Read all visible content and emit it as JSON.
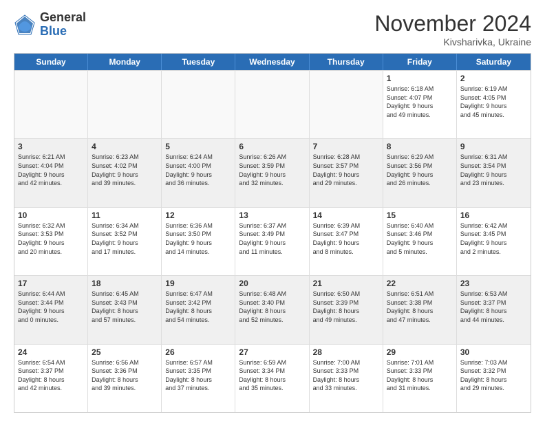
{
  "logo": {
    "general": "General",
    "blue": "Blue"
  },
  "header": {
    "title": "November 2024",
    "subtitle": "Kivsharivka, Ukraine"
  },
  "days": [
    "Sunday",
    "Monday",
    "Tuesday",
    "Wednesday",
    "Thursday",
    "Friday",
    "Saturday"
  ],
  "rows": [
    [
      {
        "day": "",
        "info": "",
        "empty": true
      },
      {
        "day": "",
        "info": "",
        "empty": true
      },
      {
        "day": "",
        "info": "",
        "empty": true
      },
      {
        "day": "",
        "info": "",
        "empty": true
      },
      {
        "day": "",
        "info": "",
        "empty": true
      },
      {
        "day": "1",
        "info": "Sunrise: 6:18 AM\nSunset: 4:07 PM\nDaylight: 9 hours\nand 49 minutes."
      },
      {
        "day": "2",
        "info": "Sunrise: 6:19 AM\nSunset: 4:05 PM\nDaylight: 9 hours\nand 45 minutes."
      }
    ],
    [
      {
        "day": "3",
        "info": "Sunrise: 6:21 AM\nSunset: 4:04 PM\nDaylight: 9 hours\nand 42 minutes."
      },
      {
        "day": "4",
        "info": "Sunrise: 6:23 AM\nSunset: 4:02 PM\nDaylight: 9 hours\nand 39 minutes."
      },
      {
        "day": "5",
        "info": "Sunrise: 6:24 AM\nSunset: 4:00 PM\nDaylight: 9 hours\nand 36 minutes."
      },
      {
        "day": "6",
        "info": "Sunrise: 6:26 AM\nSunset: 3:59 PM\nDaylight: 9 hours\nand 32 minutes."
      },
      {
        "day": "7",
        "info": "Sunrise: 6:28 AM\nSunset: 3:57 PM\nDaylight: 9 hours\nand 29 minutes."
      },
      {
        "day": "8",
        "info": "Sunrise: 6:29 AM\nSunset: 3:56 PM\nDaylight: 9 hours\nand 26 minutes."
      },
      {
        "day": "9",
        "info": "Sunrise: 6:31 AM\nSunset: 3:54 PM\nDaylight: 9 hours\nand 23 minutes."
      }
    ],
    [
      {
        "day": "10",
        "info": "Sunrise: 6:32 AM\nSunset: 3:53 PM\nDaylight: 9 hours\nand 20 minutes."
      },
      {
        "day": "11",
        "info": "Sunrise: 6:34 AM\nSunset: 3:52 PM\nDaylight: 9 hours\nand 17 minutes."
      },
      {
        "day": "12",
        "info": "Sunrise: 6:36 AM\nSunset: 3:50 PM\nDaylight: 9 hours\nand 14 minutes."
      },
      {
        "day": "13",
        "info": "Sunrise: 6:37 AM\nSunset: 3:49 PM\nDaylight: 9 hours\nand 11 minutes."
      },
      {
        "day": "14",
        "info": "Sunrise: 6:39 AM\nSunset: 3:47 PM\nDaylight: 9 hours\nand 8 minutes."
      },
      {
        "day": "15",
        "info": "Sunrise: 6:40 AM\nSunset: 3:46 PM\nDaylight: 9 hours\nand 5 minutes."
      },
      {
        "day": "16",
        "info": "Sunrise: 6:42 AM\nSunset: 3:45 PM\nDaylight: 9 hours\nand 2 minutes."
      }
    ],
    [
      {
        "day": "17",
        "info": "Sunrise: 6:44 AM\nSunset: 3:44 PM\nDaylight: 9 hours\nand 0 minutes."
      },
      {
        "day": "18",
        "info": "Sunrise: 6:45 AM\nSunset: 3:43 PM\nDaylight: 8 hours\nand 57 minutes."
      },
      {
        "day": "19",
        "info": "Sunrise: 6:47 AM\nSunset: 3:42 PM\nDaylight: 8 hours\nand 54 minutes."
      },
      {
        "day": "20",
        "info": "Sunrise: 6:48 AM\nSunset: 3:40 PM\nDaylight: 8 hours\nand 52 minutes."
      },
      {
        "day": "21",
        "info": "Sunrise: 6:50 AM\nSunset: 3:39 PM\nDaylight: 8 hours\nand 49 minutes."
      },
      {
        "day": "22",
        "info": "Sunrise: 6:51 AM\nSunset: 3:38 PM\nDaylight: 8 hours\nand 47 minutes."
      },
      {
        "day": "23",
        "info": "Sunrise: 6:53 AM\nSunset: 3:37 PM\nDaylight: 8 hours\nand 44 minutes."
      }
    ],
    [
      {
        "day": "24",
        "info": "Sunrise: 6:54 AM\nSunset: 3:37 PM\nDaylight: 8 hours\nand 42 minutes."
      },
      {
        "day": "25",
        "info": "Sunrise: 6:56 AM\nSunset: 3:36 PM\nDaylight: 8 hours\nand 39 minutes."
      },
      {
        "day": "26",
        "info": "Sunrise: 6:57 AM\nSunset: 3:35 PM\nDaylight: 8 hours\nand 37 minutes."
      },
      {
        "day": "27",
        "info": "Sunrise: 6:59 AM\nSunset: 3:34 PM\nDaylight: 8 hours\nand 35 minutes."
      },
      {
        "day": "28",
        "info": "Sunrise: 7:00 AM\nSunset: 3:33 PM\nDaylight: 8 hours\nand 33 minutes."
      },
      {
        "day": "29",
        "info": "Sunrise: 7:01 AM\nSunset: 3:33 PM\nDaylight: 8 hours\nand 31 minutes."
      },
      {
        "day": "30",
        "info": "Sunrise: 7:03 AM\nSunset: 3:32 PM\nDaylight: 8 hours\nand 29 minutes."
      }
    ]
  ]
}
